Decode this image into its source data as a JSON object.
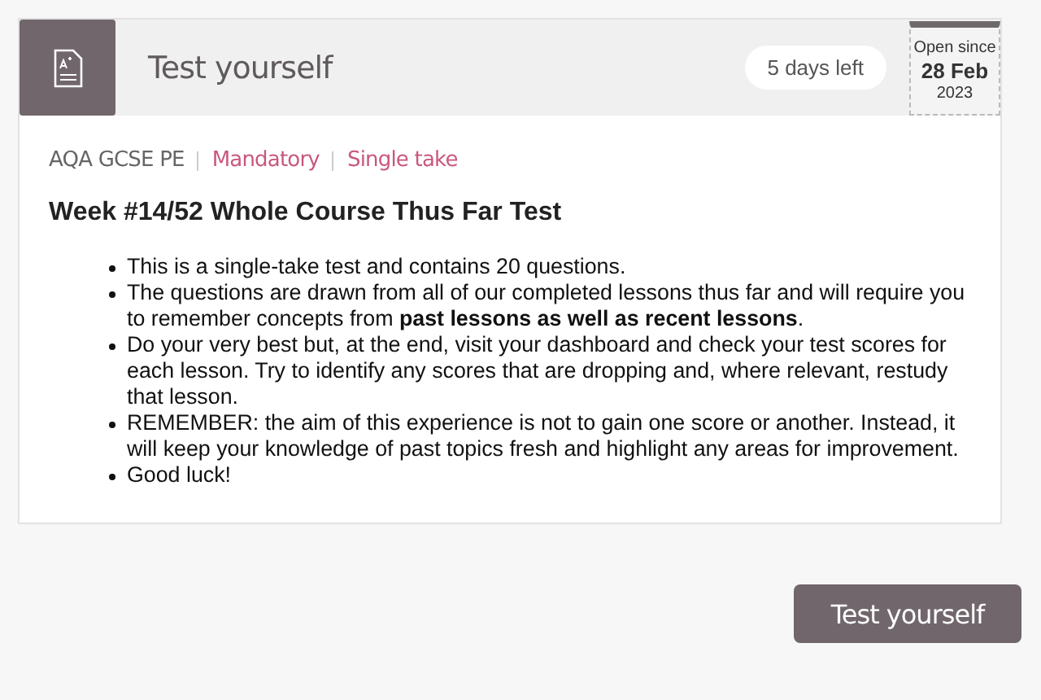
{
  "header": {
    "title": "Test yourself",
    "time_left": "5 days left",
    "open_since": {
      "label": "Open since",
      "date": "28 Feb",
      "year": "2023"
    }
  },
  "tags": [
    {
      "text": "AQA GCSE PE",
      "kind": "subject"
    },
    {
      "text": "Mandatory",
      "kind": "flag"
    },
    {
      "text": "Single take",
      "kind": "flag"
    }
  ],
  "heading": "Week #14/52 Whole Course Thus Far Test",
  "bullets": [
    "This is a single-take test and contains 20 questions.",
    "The questions are drawn from all of our completed lessons thus far and will require you to remember concepts from **past lessons as well as recent lessons**.",
    "Do your very best but, at the end, visit your dashboard and check your test scores for each lesson. Try to identify any scores that are dropping and, where relevant, restudy that lesson.",
    "REMEMBER: the aim of this experience is not to gain one score or another. Instead, it will keep your knowledge of past topics fresh and highlight any areas for improvement.",
    "Good luck!"
  ],
  "button": "Test yourself"
}
